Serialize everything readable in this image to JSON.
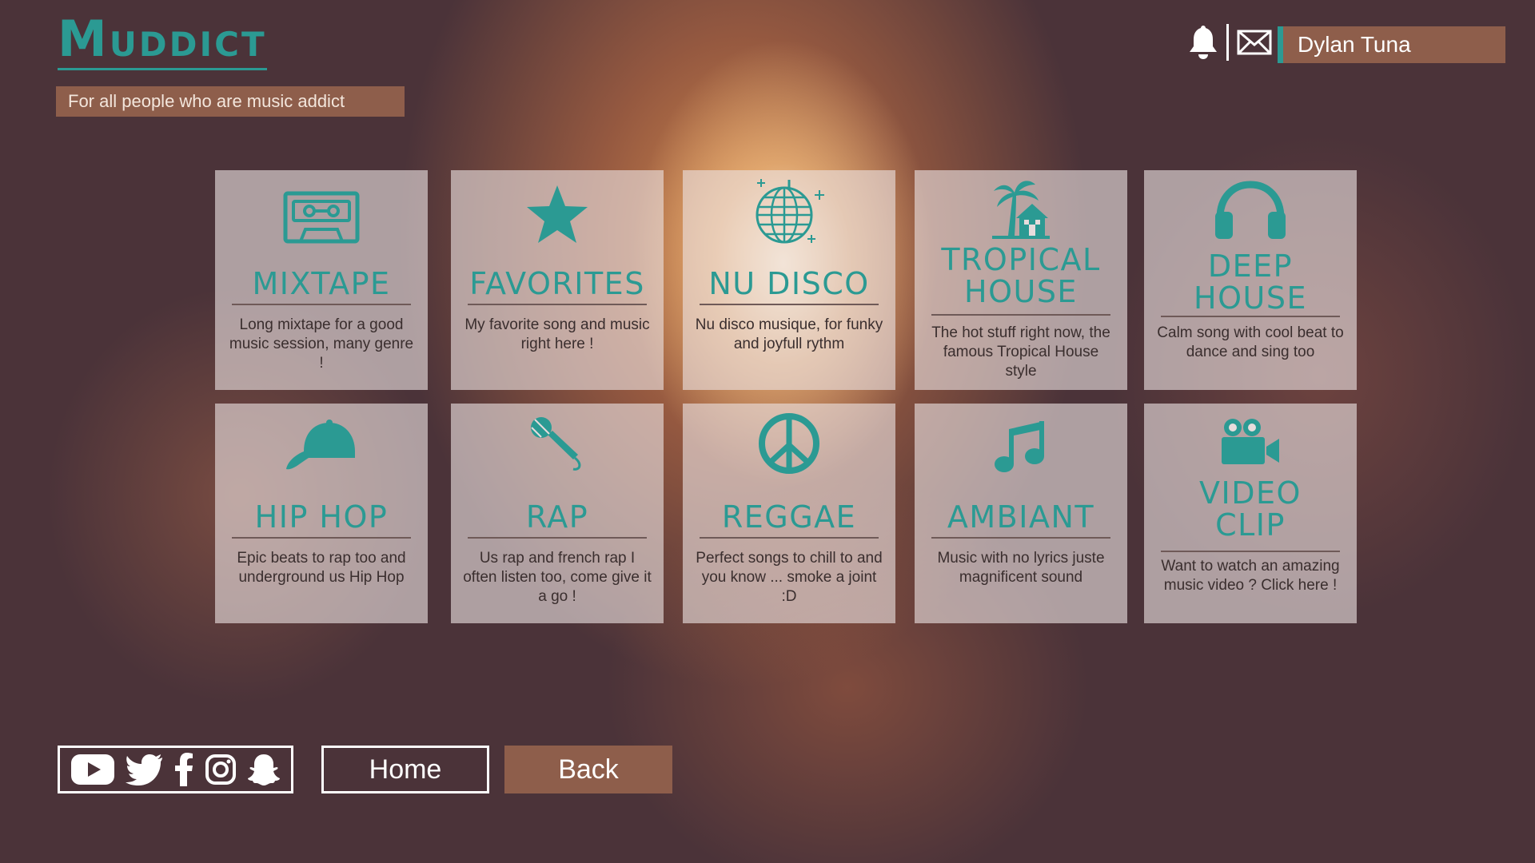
{
  "app": {
    "logo_first": "M",
    "logo_rest": "UDDICT",
    "tagline": "For all people who are music addict"
  },
  "header": {
    "user_name": "Dylan Tuna",
    "icons": [
      "bell-icon",
      "mail-icon"
    ]
  },
  "colors": {
    "accent": "#2b9a93",
    "brown": "#8e5e4b",
    "tile_bg": "#e7dcdc",
    "text_dark": "#3a2e2e"
  },
  "tiles": [
    {
      "title": "MIXTAPE",
      "desc": "Long mixtape for a good music session, many genre !",
      "icon": "cassette-icon"
    },
    {
      "title": "FAVORITES",
      "desc": "My favorite song and music right here !",
      "icon": "star-icon"
    },
    {
      "title": "NU DISCO",
      "desc": "Nu disco musique, for funky and joyfull rythm",
      "icon": "disco-ball-icon"
    },
    {
      "title": "TROPICAL\nHOUSE",
      "desc": "The hot stuff right now, the famous Tropical House style",
      "icon": "palm-house-icon"
    },
    {
      "title": "DEEP\nHOUSE",
      "desc": "Calm song with cool beat to dance and sing too",
      "icon": "headphones-icon"
    },
    {
      "title": "HIP HOP",
      "desc": "Epic beats to rap too and underground us Hip Hop",
      "icon": "cap-icon"
    },
    {
      "title": "RAP",
      "desc": "Us rap and french rap I often listen too, come give it a go !",
      "icon": "microphone-icon"
    },
    {
      "title": "REGGAE",
      "desc": "Perfect songs to chill to and you know ... smoke a joint :D",
      "icon": "peace-icon"
    },
    {
      "title": "AMBIANT",
      "desc": "Music with no lyrics juste magnificent sound",
      "icon": "music-note-icon"
    },
    {
      "title": "VIDEO\nCLIP",
      "desc": "Want to watch an amazing music video ? Click here !",
      "icon": "video-camera-icon"
    }
  ],
  "footer": {
    "social": [
      "youtube-icon",
      "twitter-icon",
      "facebook-icon",
      "instagram-icon",
      "snapchat-icon"
    ],
    "home_label": "Home",
    "back_label": "Back"
  }
}
